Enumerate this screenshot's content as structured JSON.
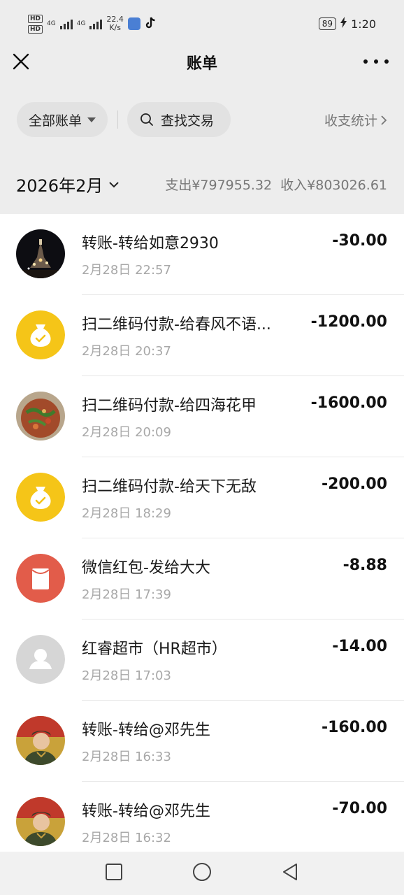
{
  "status_bar": {
    "hd1": "HD",
    "hd2": "HD",
    "net1": "4G",
    "net2": "4G",
    "speed_value": "22.4",
    "speed_unit": "K/s",
    "battery": "89",
    "time": "1:20"
  },
  "header": {
    "title": "账单"
  },
  "filters": {
    "all_bills": "全部账单",
    "search": "查找交易",
    "stats": "收支统计"
  },
  "month": {
    "label": "2026年2月",
    "expense": "支出¥797955.32",
    "income": "收入¥803026.61"
  },
  "transactions": [
    {
      "title": "转账-转给如意2930",
      "time": "2月28日 22:57",
      "amount": "-30.00",
      "avatar": "night-temple-photo"
    },
    {
      "title": "扫二维码付款-给春风不语...",
      "time": "2月28日 20:37",
      "amount": "-1200.00",
      "avatar": "money-bag-icon"
    },
    {
      "title": "扫二维码付款-给四海花甲",
      "time": "2月28日 20:09",
      "amount": "-1600.00",
      "avatar": "food-photo"
    },
    {
      "title": "扫二维码付款-给天下无敌",
      "time": "2月28日 18:29",
      "amount": "-200.00",
      "avatar": "money-bag-icon"
    },
    {
      "title": "微信红包-发给大大",
      "time": "2月28日 17:39",
      "amount": "-8.88",
      "avatar": "red-packet-icon"
    },
    {
      "title": "红睿超市（HR超市）",
      "time": "2月28日 17:03",
      "amount": "-14.00",
      "avatar": "default-user-icon"
    },
    {
      "title": "转账-转给@邓先生",
      "time": "2月28日 16:33",
      "amount": "-160.00",
      "avatar": "soldier-photo"
    },
    {
      "title": "转账-转给@邓先生",
      "time": "2月28日 16:32",
      "amount": "-70.00",
      "avatar": "soldier-photo"
    }
  ],
  "colors": {
    "background": "#ededed",
    "list_background": "#ffffff",
    "money_bag": "#f5c518",
    "red_packet": "#e25c4a",
    "muted_text": "#a8a8a8"
  }
}
